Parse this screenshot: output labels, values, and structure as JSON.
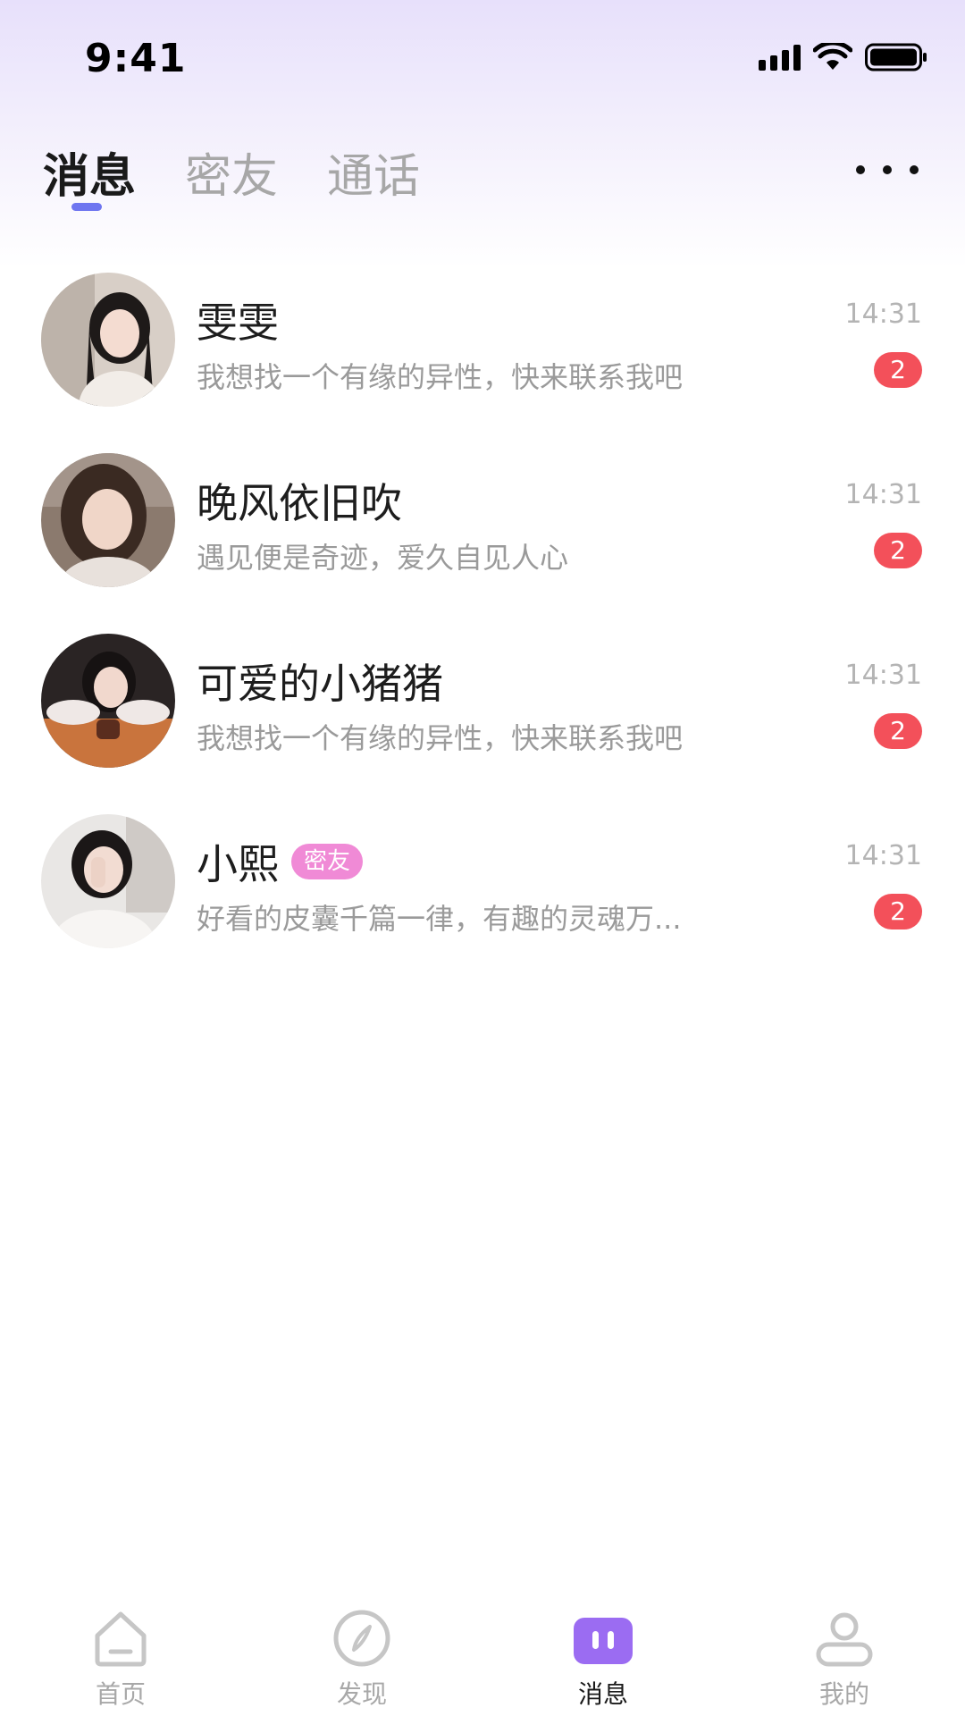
{
  "status_bar": {
    "time": "9:41"
  },
  "tabs": [
    {
      "label": "消息",
      "active": true
    },
    {
      "label": "密友",
      "active": false
    },
    {
      "label": "通话",
      "active": false
    }
  ],
  "more_icon": "more-horizontal-icon",
  "conversations": [
    {
      "name": "雯雯",
      "preview": "我想找一个有缘的异性，快来联系我吧",
      "time": "14:31",
      "unread": "2",
      "tag": ""
    },
    {
      "name": "晚风依旧吹",
      "preview": "遇见便是奇迹，爱久自见人心",
      "time": "14:31",
      "unread": "2",
      "tag": ""
    },
    {
      "name": "可爱的小猪猪",
      "preview": "我想找一个有缘的异性，快来联系我吧",
      "time": "14:31",
      "unread": "2",
      "tag": ""
    },
    {
      "name": "小熙",
      "preview": "好看的皮囊千篇一律，有趣的灵魂万...",
      "time": "14:31",
      "unread": "2",
      "tag": "密友"
    }
  ],
  "bottom_nav": [
    {
      "label": "首页",
      "icon": "home-icon",
      "active": false
    },
    {
      "label": "发现",
      "icon": "compass-icon",
      "active": false
    },
    {
      "label": "消息",
      "icon": "message-icon",
      "active": true
    },
    {
      "label": "我的",
      "icon": "profile-icon",
      "active": false
    }
  ],
  "colors": {
    "accent": "#6e75f0",
    "badge": "#f3505a",
    "tag": "#f08ad6",
    "nav_active": "#9b6cf2"
  }
}
